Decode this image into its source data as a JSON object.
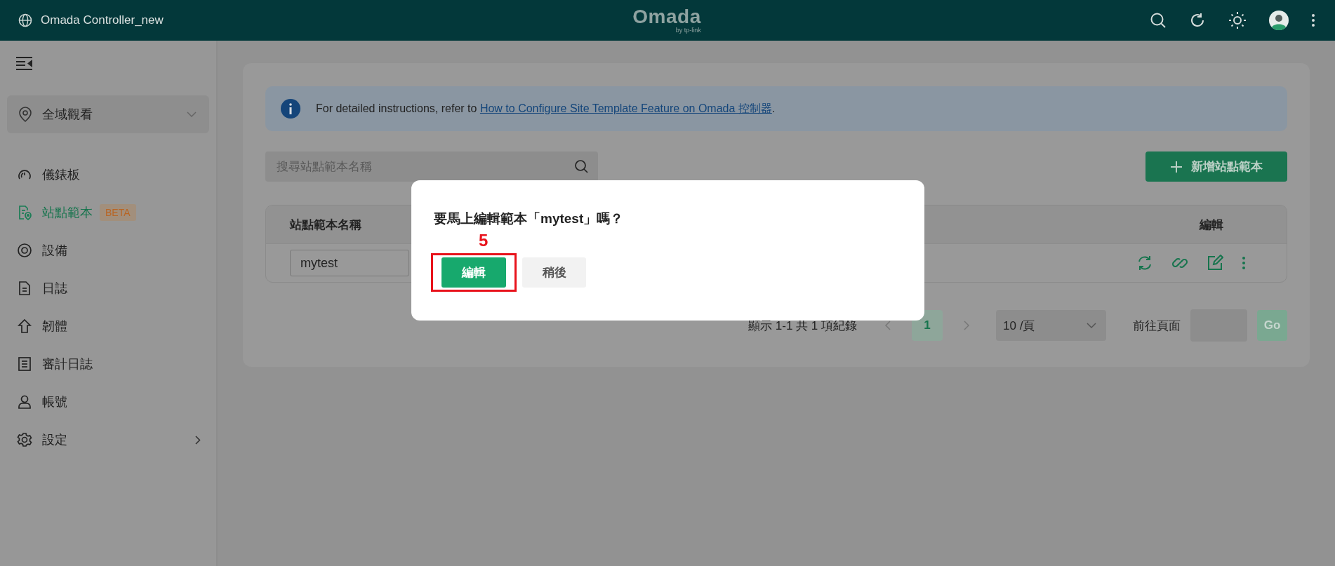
{
  "header": {
    "title": "Omada Controller_new",
    "logo": {
      "name": "Omada",
      "tagline": "by tp-link"
    }
  },
  "sidebar": {
    "region_selector": {
      "label": "全域觀看"
    },
    "items": [
      {
        "label": "儀錶板",
        "selected": false,
        "kind": "link"
      },
      {
        "label": "站點範本",
        "selected": true,
        "kind": "link",
        "badge": "BETA"
      },
      {
        "label": "設備",
        "selected": false,
        "kind": "link"
      },
      {
        "label": "日誌",
        "selected": false,
        "kind": "link"
      },
      {
        "label": "韌體",
        "selected": false,
        "kind": "link"
      },
      {
        "label": "審計日誌",
        "selected": false,
        "kind": "link"
      },
      {
        "label": "帳號",
        "selected": false,
        "kind": "link"
      },
      {
        "label": "設定",
        "selected": false,
        "kind": "group"
      }
    ]
  },
  "info_banner": {
    "text": "For detailed instructions, refer to ",
    "link": "How to Configure Site Template Feature on Omada 控制器",
    "end": "."
  },
  "search": {
    "placeholder": "搜尋站點範本名稱"
  },
  "add_button": {
    "label": "新增站點範本"
  },
  "table": {
    "columns": [
      "站點範本名稱",
      "編輯"
    ],
    "rows": [
      {
        "name": "mytest"
      }
    ]
  },
  "pagination": {
    "summary": "顯示 1-1 共 1 項紀錄",
    "pages": [
      {
        "label": "1",
        "selected": true
      }
    ],
    "page_size": "10 /頁",
    "goto_label": "前往頁面",
    "go_button": {
      "label": "Go",
      "disabled": true
    }
  },
  "dialog": {
    "title": "要馬上編輯範本「mytest」嗎？",
    "step_marker": "5",
    "buttons": [
      {
        "label": "編輯",
        "kind": "primary"
      },
      {
        "label": "稍後",
        "kind": "secondary"
      }
    ]
  }
}
